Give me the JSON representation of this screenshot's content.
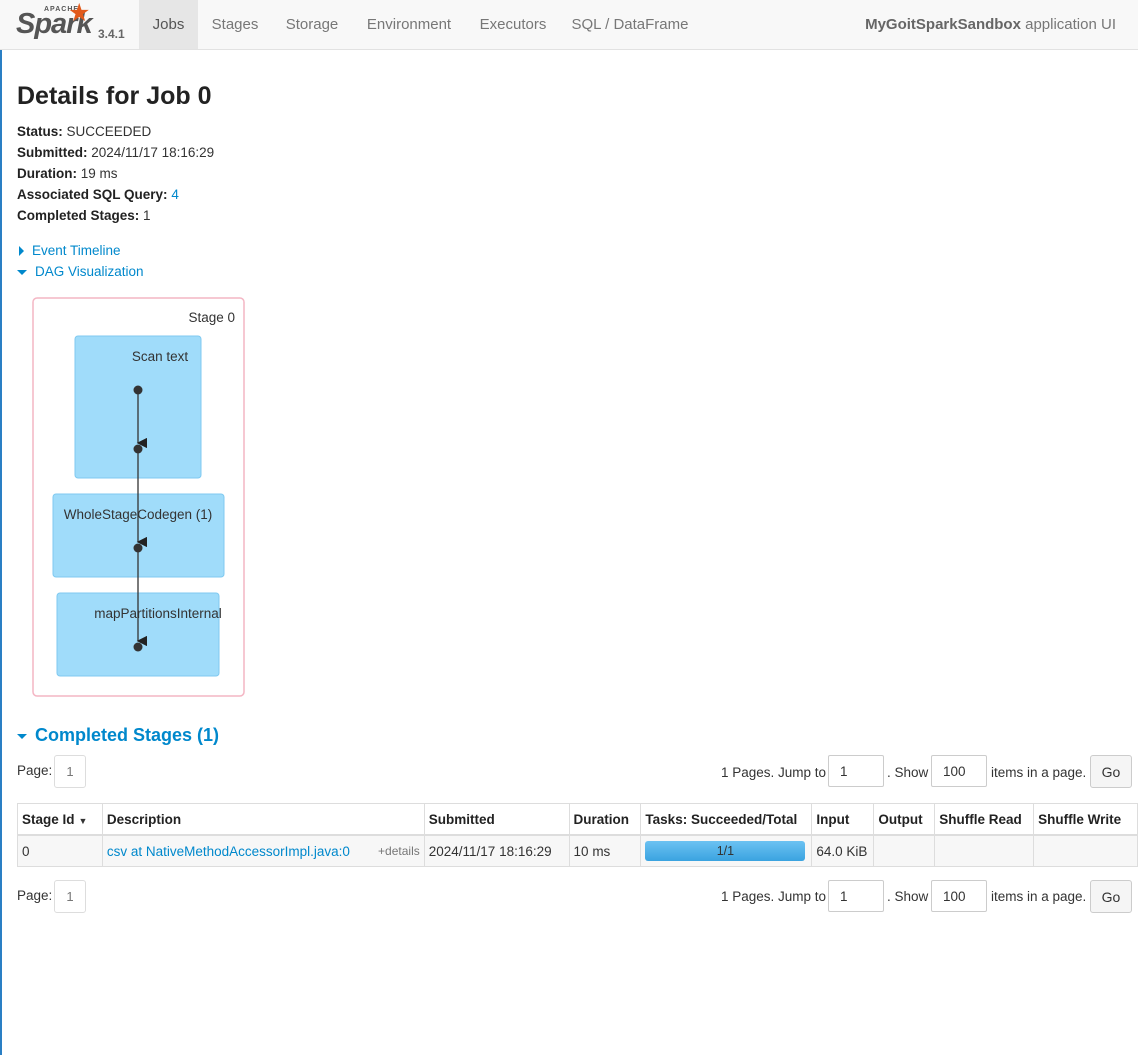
{
  "navbar": {
    "brand": {
      "apache": "APACHE",
      "name": "Spark",
      "version": "3.4.1"
    },
    "tabs": [
      {
        "label": "Jobs",
        "active": true
      },
      {
        "label": "Stages",
        "active": false
      },
      {
        "label": "Storage",
        "active": false
      },
      {
        "label": "Environment",
        "active": false
      },
      {
        "label": "Executors",
        "active": false
      },
      {
        "label": "SQL / DataFrame",
        "active": false
      }
    ],
    "app_name": "MyGoitSparkSandbox",
    "app_suffix": "application UI"
  },
  "page": {
    "title": "Details for Job 0"
  },
  "summary": {
    "status_label": "Status:",
    "status": "SUCCEEDED",
    "submitted_label": "Submitted:",
    "submitted": "2024/11/17 18:16:29",
    "duration_label": "Duration:",
    "duration": "19 ms",
    "sql_label": "Associated SQL Query:",
    "sql_query": "4",
    "completed_label": "Completed Stages:",
    "completed_count": "1"
  },
  "toggles": {
    "event_timeline": "Event Timeline",
    "dag": "DAG Visualization"
  },
  "dag": {
    "stage_label": "Stage 0",
    "nodes": [
      "Scan text",
      "WholeStageCodegen (1)",
      "mapPartitionsInternal"
    ]
  },
  "completed_stages": {
    "heading": "Completed Stages (1)",
    "pager": {
      "page_label": "Page:",
      "current_page": "1",
      "pages_text": "1 Pages. Jump to",
      "jump_value": "1",
      "show_text": ". Show",
      "show_value": "100",
      "items_text": "items in a page.",
      "go_label": "Go"
    },
    "columns": [
      "Stage Id",
      "Description",
      "Submitted",
      "Duration",
      "Tasks: Succeeded/Total",
      "Input",
      "Output",
      "Shuffle Read",
      "Shuffle Write"
    ],
    "rows": [
      {
        "stage_id": "0",
        "description": "csv at NativeMethodAccessorImpl.java:0",
        "details": "+details",
        "submitted": "2024/11/17 18:16:29",
        "duration": "10 ms",
        "tasks": "1/1",
        "tasks_fraction": 1.0,
        "input": "64.0 KiB",
        "output": "",
        "shuffle_read": "",
        "shuffle_write": ""
      }
    ]
  },
  "colors": {
    "link": "#0088cc",
    "spark_orange": "#e25a1c",
    "dag_node": "#a0dcfa",
    "dag_stage_border": "#f4b6c4",
    "progress": "#4ab0ea"
  }
}
